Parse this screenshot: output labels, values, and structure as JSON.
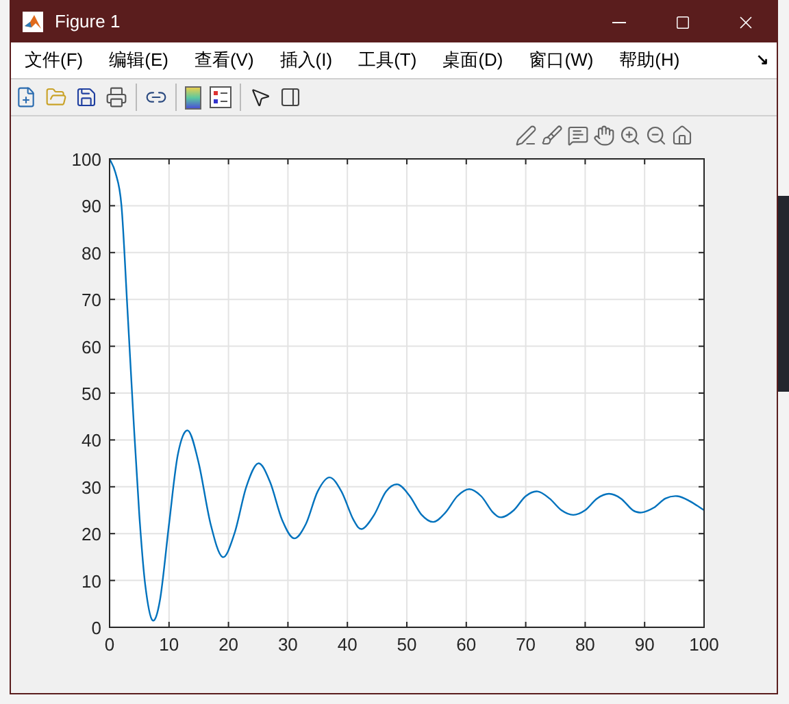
{
  "window": {
    "title": "Figure 1"
  },
  "menu": [
    {
      "label": "文件(F)"
    },
    {
      "label": "编辑(E)"
    },
    {
      "label": "查看(V)"
    },
    {
      "label": "插入(I)"
    },
    {
      "label": "工具(T)"
    },
    {
      "label": "桌面(D)"
    },
    {
      "label": "窗口(W)"
    },
    {
      "label": "帮助(H)"
    }
  ],
  "menu_overflow": "↘",
  "chart_data": {
    "type": "line",
    "x": [
      0,
      1,
      2,
      3,
      4,
      5,
      6,
      7.2,
      8.5,
      10,
      11.5,
      13.2,
      15,
      17,
      19,
      21,
      23,
      25,
      27,
      29,
      31,
      33,
      35,
      37,
      39,
      41,
      42.5,
      44.5,
      46.5,
      48.5,
      50.5,
      52.5,
      54.5,
      56.5,
      58.5,
      60.5,
      62.5,
      64.5,
      66,
      68,
      70,
      72,
      74,
      76,
      78,
      80,
      82,
      84,
      86,
      88,
      89.5,
      91.5,
      93.5,
      95.5,
      97.5,
      100
    ],
    "series": [
      {
        "color": "#0072bd",
        "values": [
          100,
          97,
          90,
          68,
          45,
          24,
          9,
          1.5,
          6,
          22,
          37,
          42,
          35,
          22,
          15,
          20,
          30,
          35,
          31,
          23,
          19,
          22,
          29,
          32,
          29,
          23,
          21,
          24,
          29,
          30.5,
          28,
          24,
          22.5,
          24.5,
          28,
          29.5,
          28,
          24.5,
          23.5,
          25,
          28,
          29,
          27.5,
          25,
          24,
          25,
          27.5,
          28.5,
          27.5,
          25,
          24.5,
          25.5,
          27.5,
          28,
          27,
          25
        ]
      }
    ],
    "grid": true,
    "xlim": [
      0,
      100
    ],
    "ylim": [
      0,
      100
    ],
    "xticks": [
      0,
      10,
      20,
      30,
      40,
      50,
      60,
      70,
      80,
      90,
      100
    ],
    "yticks": [
      0,
      10,
      20,
      30,
      40,
      50,
      60,
      70,
      80,
      90,
      100
    ]
  }
}
